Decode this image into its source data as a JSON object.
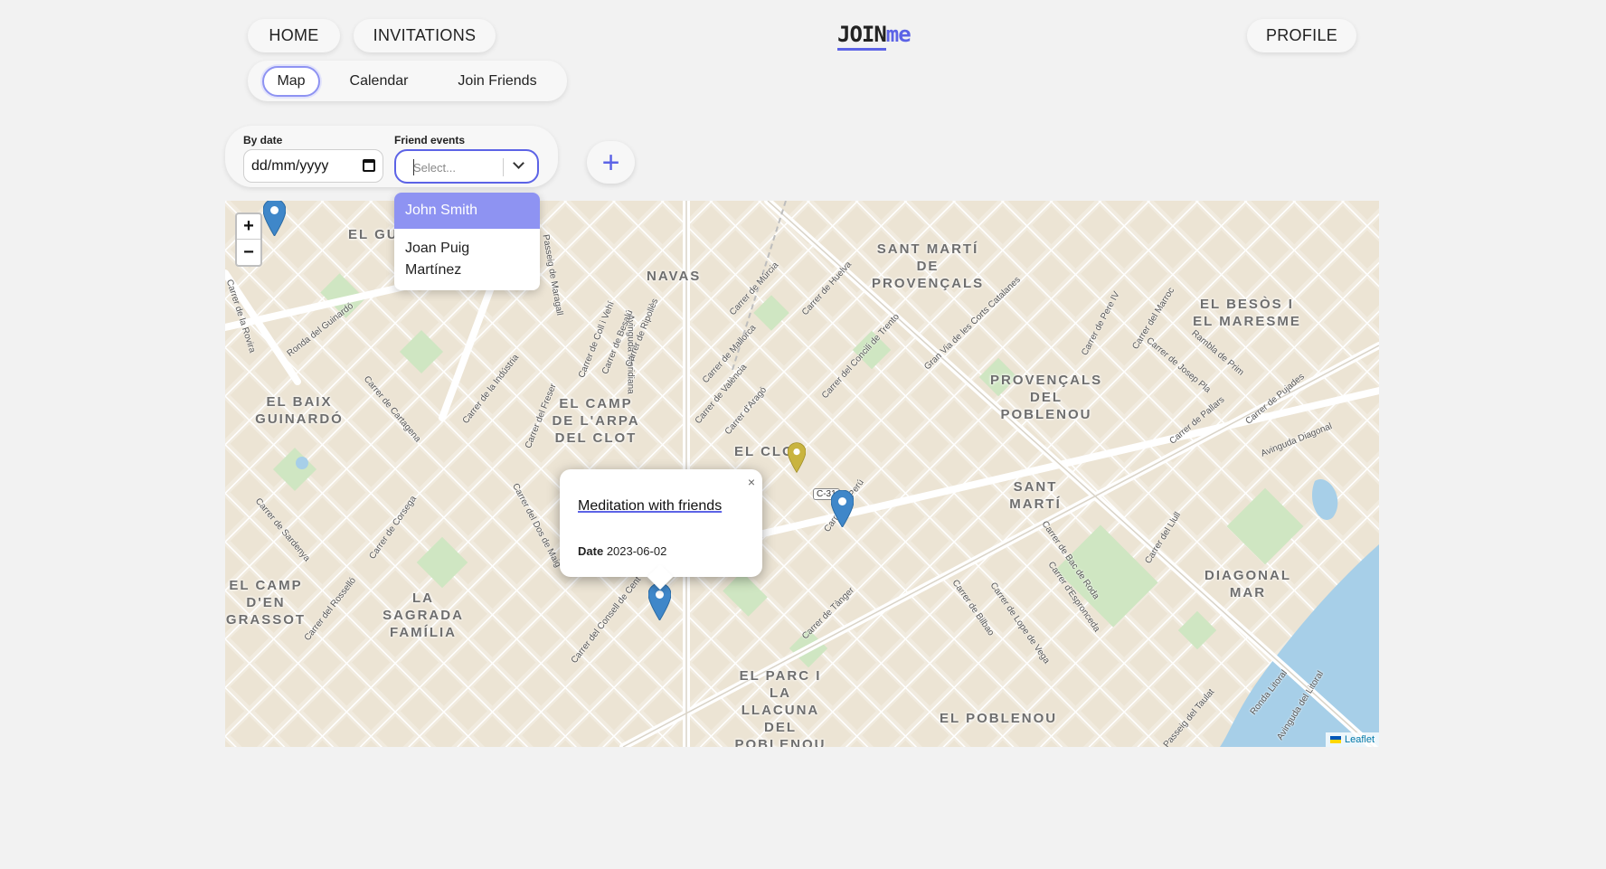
{
  "nav": {
    "home": "HOME",
    "invitations": "INVITATIONS",
    "profile": "PROFILE",
    "logo_part1": "JOIN",
    "logo_part2": "me"
  },
  "subnav": {
    "tabs": [
      "Map",
      "Calendar",
      "Join Friends"
    ],
    "active": "Map"
  },
  "filters": {
    "date_label": "By date",
    "date_value": "dd/mm/yyyy",
    "friend_label": "Friend events",
    "friend_placeholder": "Select...",
    "options": [
      "John Smith",
      "Joan Puig Martínez"
    ],
    "highlighted_option": "John Smith"
  },
  "add_button": "+",
  "map": {
    "zoom_in": "+",
    "zoom_out": "−",
    "attribution": "Leaflet",
    "districts": [
      "EL GU",
      "NAVAS",
      "SANT MARTÍ DE PROVENÇALS",
      "EL BESÒS I EL MARESME",
      "EL BAIX GUINARDÓ",
      "EL CAMP DE L'ARPA DEL CLOT",
      "PROVENÇALS DEL POBLENOU",
      "EL CLO",
      "SANT MARTÍ",
      "DIAGONAL MAR",
      "EL CAMP D'EN GRASSOT",
      "LA SAGRADA FAMÍLIA",
      "EL PARC I LA LLACUNA DEL POBLENOU",
      "EL POBLENOU"
    ],
    "streets": [
      "Ronda del Guinardó",
      "Carrer de Cartagena",
      "Carrer de la Indústria",
      "Carrer del Freser",
      "Avinguda Meridiana",
      "Carrer de Mallorca",
      "Carrer de València",
      "Carrer d'Aragó",
      "Carrer del Consell de Cent",
      "Gran Via de les Corts Catalanes",
      "Avinguda Diagonal",
      "Carrer de Pere IV",
      "Carrer del Perú",
      "Carrer de Bac de Roda",
      "Carrer de Bilbao",
      "Carrer del Llull",
      "Carrer de Tànger",
      "Carrer de Sardenya",
      "Carrer del Rosselló",
      "Passeig de Maragall",
      "Carrer de Múrcia",
      "Carrer de Huelva",
      "Carrer del Concili de Trento",
      "Rambla de Prim",
      "Carrer de Josep Pla",
      "Carrer de Pallars",
      "Carrer de Pujades",
      "Passeig del Taulat",
      "Ronda Litoral",
      "Avinguda del Litoral",
      "Carrer del Marroc",
      "Carrer d'Espronceda",
      "Carrer de Lope de Vega",
      "Carrer de Corsega",
      "Carrer del Dos de Maig",
      "Carrer de la Rovira",
      "Carrer de Besalú",
      "Carrer de Ripollès",
      "Carrer de Coll i Vehí"
    ],
    "road_badge": "C-31",
    "markers": [
      {
        "name": "blue",
        "color": "#3f87c9"
      },
      {
        "name": "yellow",
        "color": "#c9b43f"
      },
      {
        "name": "blue",
        "color": "#3f87c9"
      },
      {
        "name": "blue",
        "color": "#3f87c9"
      }
    ]
  },
  "popup": {
    "title": "Meditation with friends",
    "date_label": "Date",
    "date_value": "2023-06-02",
    "close": "×"
  },
  "colors": {
    "accent": "#5c63e6",
    "accent_light": "#8e93f2",
    "map_land": "#f1ebdf",
    "map_park": "#cfe6c2",
    "map_water": "#a7cfe8"
  }
}
